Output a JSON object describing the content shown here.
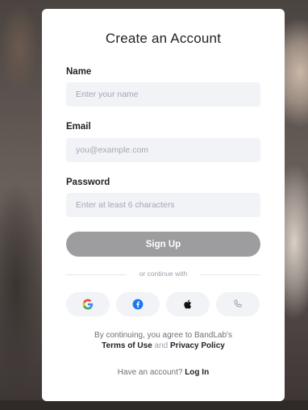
{
  "form": {
    "title": "Create an Account",
    "name_label": "Name",
    "name_placeholder": "Enter your name",
    "name_value": "",
    "email_label": "Email",
    "email_placeholder": "you@example.com",
    "email_value": "",
    "password_label": "Password",
    "password_placeholder": "Enter at least 6 characters",
    "password_value": "",
    "signup_label": "Sign Up",
    "divider_text": "or continue with"
  },
  "social": [
    {
      "icon": "google-icon"
    },
    {
      "icon": "facebook-icon"
    },
    {
      "icon": "apple-icon"
    },
    {
      "icon": "phone-icon"
    }
  ],
  "legal": {
    "prefix": "By continuing, you agree to BandLab's",
    "terms": "Terms of Use",
    "and": "and",
    "privacy": "Privacy Policy"
  },
  "login": {
    "prompt": "Have an account?",
    "link": "Log In"
  },
  "colors": {
    "signup_button": "#9d9d9f",
    "input_bg": "#f1f3f6",
    "facebook": "#1877f2",
    "google_blue": "#4285f4",
    "google_red": "#ea4335",
    "google_yellow": "#fbbc05",
    "google_green": "#34a853"
  }
}
